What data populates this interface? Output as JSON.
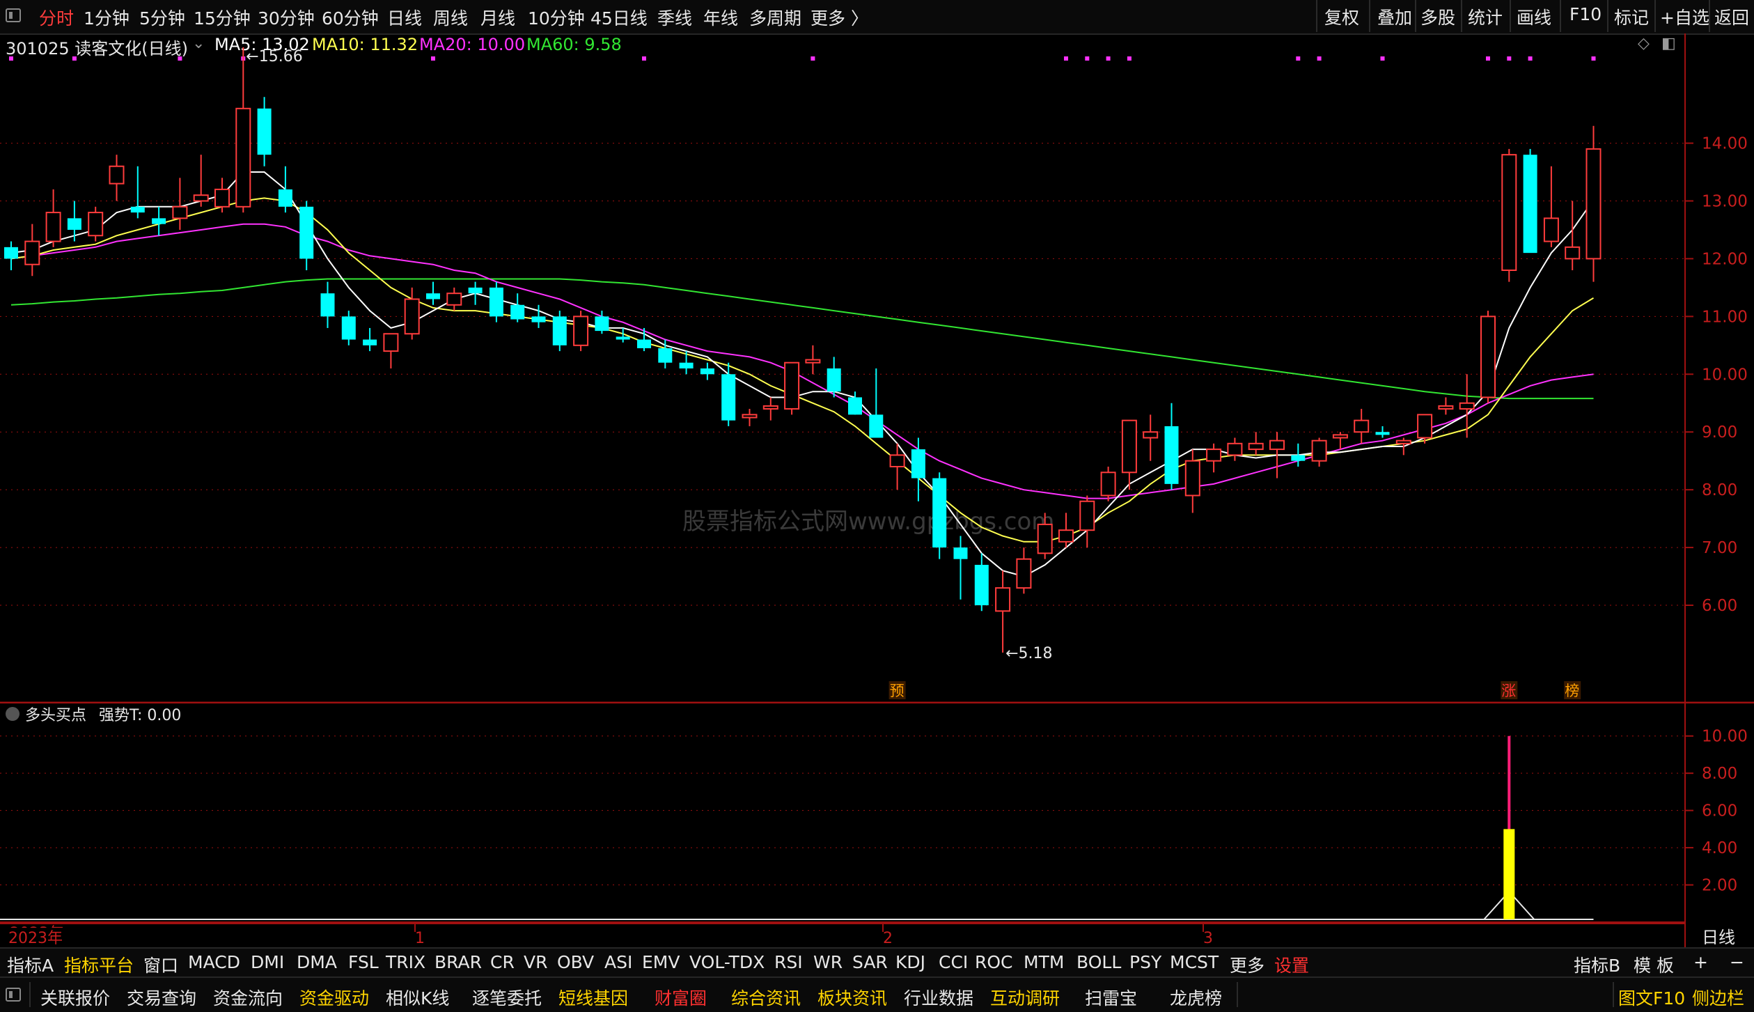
{
  "toolbar": {
    "periods": [
      "分时",
      "1分钟",
      "5分钟",
      "15分钟",
      "30分钟",
      "60分钟",
      "日线",
      "周线",
      "月线",
      "10分钟",
      "45日线",
      "季线",
      "年线",
      "多周期",
      "更多 〉"
    ],
    "active_period": "分时",
    "tools": [
      "复权",
      "叠加",
      "多股",
      "统计",
      "画线",
      "F10",
      "标记",
      "+自选",
      "返回"
    ]
  },
  "header": {
    "stock": "301025 读客文化(日线)",
    "ma5": "MA5: 13.02",
    "ma10": "MA10: 11.32",
    "ma20": "MA20: 10.00",
    "ma60": "MA60: 9.58"
  },
  "indicator_header": {
    "name": "多头买点",
    "value": "强势T: 0.00"
  },
  "watermark": "股票指标公式网www.gpzbgs.com",
  "markers": {
    "yu": "预",
    "zhang": "涨",
    "bang": "榜"
  },
  "colors": {
    "up": "#ff3c3c",
    "down": "#00ffff",
    "ma5": "#ffffff",
    "ma10": "#ffff50",
    "ma20": "#ff32ff",
    "ma60": "#32e632",
    "grid": "#a01010"
  },
  "x_labels": {
    "year": "2023年",
    "m1": "1",
    "m2": "2",
    "m3": "3",
    "corner": "日线"
  },
  "tabs": [
    "指标A",
    "指标平台",
    "窗口",
    "MACD",
    "DMI",
    "DMA",
    "FSL",
    "TRIX",
    "BRAR",
    "CR",
    "VR",
    "OBV",
    "ASI",
    "EMV",
    "VOL-TDX",
    "RSI",
    "WR",
    "SAR",
    "KDJ",
    "CCI",
    "ROC",
    "MTM",
    "BOLL",
    "PSY",
    "MCST",
    "更多",
    "设置"
  ],
  "tabs_right": [
    "指标B",
    "模 板",
    "+",
    "−"
  ],
  "bottom_tabs": [
    "关联报价",
    "交易查询",
    "资金流向",
    "资金驱动",
    "相似K线",
    "逐笔委托",
    "短线基因",
    "财富圈",
    "综合资讯",
    "板块资讯",
    "行业数据",
    "互动调研",
    "扫雷宝",
    "龙虎榜"
  ],
  "bottom_right": [
    "图文F10",
    "侧边栏"
  ],
  "chart_data": [
    {
      "type": "candlestick",
      "title": "301025 读客文化(日线)",
      "y_ticks": [
        "6.00",
        "7.00",
        "8.00",
        "9.00",
        "10.00",
        "11.00",
        "12.00",
        "13.00",
        "14.00"
      ],
      "ylim": [
        4.3,
        15.9
      ],
      "annotations": {
        "high": "15.66",
        "low": "5.18"
      },
      "ohlc": [
        [
          12.2,
          12.3,
          11.8,
          12.0
        ],
        [
          11.9,
          12.6,
          11.7,
          12.3
        ],
        [
          12.3,
          13.2,
          12.2,
          12.8
        ],
        [
          12.7,
          13.0,
          12.3,
          12.5
        ],
        [
          12.4,
          12.9,
          12.3,
          12.8
        ],
        [
          13.3,
          13.8,
          13.0,
          13.6
        ],
        [
          12.9,
          13.6,
          12.7,
          12.8
        ],
        [
          12.7,
          12.9,
          12.4,
          12.6
        ],
        [
          12.7,
          13.4,
          12.5,
          12.9
        ],
        [
          13.0,
          13.8,
          12.9,
          13.1
        ],
        [
          12.9,
          13.4,
          12.8,
          13.2
        ],
        [
          12.9,
          15.66,
          12.8,
          14.6
        ],
        [
          14.6,
          14.8,
          13.6,
          13.8
        ],
        [
          13.2,
          13.6,
          12.8,
          12.9
        ],
        [
          12.9,
          13.0,
          11.8,
          12.0
        ],
        [
          11.4,
          11.6,
          10.8,
          11.0
        ],
        [
          11.0,
          11.1,
          10.5,
          10.6
        ],
        [
          10.6,
          10.8,
          10.4,
          10.5
        ],
        [
          10.4,
          10.7,
          10.1,
          10.7
        ],
        [
          10.7,
          11.5,
          10.6,
          11.3
        ],
        [
          11.4,
          11.6,
          11.2,
          11.3
        ],
        [
          11.2,
          11.5,
          11.1,
          11.4
        ],
        [
          11.5,
          11.6,
          11.2,
          11.4
        ],
        [
          11.5,
          11.6,
          10.9,
          11.0
        ],
        [
          11.2,
          11.4,
          10.9,
          10.95
        ],
        [
          11.0,
          11.2,
          10.8,
          10.9
        ],
        [
          11.0,
          11.1,
          10.4,
          10.5
        ],
        [
          10.5,
          11.1,
          10.4,
          11.0
        ],
        [
          11.0,
          11.1,
          10.7,
          10.75
        ],
        [
          10.65,
          10.8,
          10.55,
          10.6
        ],
        [
          10.6,
          10.8,
          10.4,
          10.45
        ],
        [
          10.45,
          10.6,
          10.1,
          10.2
        ],
        [
          10.2,
          10.4,
          10.0,
          10.1
        ],
        [
          10.1,
          10.2,
          9.9,
          10.0
        ],
        [
          10.0,
          10.2,
          9.1,
          9.2
        ],
        [
          9.25,
          9.4,
          9.1,
          9.3
        ],
        [
          9.4,
          9.6,
          9.2,
          9.45
        ],
        [
          9.4,
          10.2,
          9.3,
          10.2
        ],
        [
          10.2,
          10.5,
          10.0,
          10.25
        ],
        [
          10.1,
          10.3,
          9.6,
          9.7
        ],
        [
          9.6,
          9.7,
          9.3,
          9.3
        ],
        [
          9.3,
          10.1,
          9.0,
          8.9
        ],
        [
          8.4,
          8.8,
          8.0,
          8.6
        ],
        [
          8.7,
          8.9,
          7.8,
          8.2
        ],
        [
          8.2,
          8.3,
          6.8,
          7.0
        ],
        [
          7.0,
          7.2,
          6.1,
          6.8
        ],
        [
          6.7,
          6.9,
          5.9,
          6.0
        ],
        [
          5.9,
          6.6,
          5.18,
          6.3
        ],
        [
          6.3,
          7.0,
          6.2,
          6.8
        ],
        [
          6.9,
          7.6,
          6.8,
          7.4
        ],
        [
          7.1,
          7.6,
          7.0,
          7.3
        ],
        [
          7.3,
          7.9,
          7.0,
          7.8
        ],
        [
          7.9,
          8.4,
          7.8,
          8.3
        ],
        [
          8.3,
          9.2,
          8.0,
          9.2
        ],
        [
          8.9,
          9.3,
          8.5,
          9.0
        ],
        [
          9.1,
          9.5,
          8.0,
          8.1
        ],
        [
          7.9,
          8.7,
          7.6,
          8.5
        ],
        [
          8.5,
          8.8,
          8.3,
          8.7
        ],
        [
          8.6,
          8.9,
          8.5,
          8.8
        ],
        [
          8.7,
          9.0,
          8.6,
          8.8
        ],
        [
          8.7,
          9.0,
          8.2,
          8.85
        ],
        [
          8.6,
          8.8,
          8.4,
          8.5
        ],
        [
          8.5,
          8.9,
          8.4,
          8.85
        ],
        [
          8.9,
          9.0,
          8.7,
          8.95
        ],
        [
          9.0,
          9.4,
          8.8,
          9.2
        ],
        [
          9.0,
          9.1,
          8.9,
          8.95
        ],
        [
          8.8,
          8.9,
          8.6,
          8.85
        ],
        [
          8.9,
          9.3,
          8.8,
          9.3
        ],
        [
          9.4,
          9.6,
          9.3,
          9.45
        ],
        [
          9.4,
          10.0,
          8.9,
          9.5
        ],
        [
          9.6,
          11.1,
          9.5,
          11.0
        ],
        [
          11.8,
          13.9,
          11.6,
          13.8
        ],
        [
          13.8,
          13.9,
          12.2,
          12.1
        ],
        [
          12.3,
          13.6,
          12.2,
          12.7
        ],
        [
          12.0,
          13.0,
          11.8,
          12.2
        ],
        [
          12.0,
          14.3,
          11.6,
          13.9
        ]
      ],
      "ma5": [
        12.1,
        12.15,
        12.3,
        12.4,
        12.5,
        12.8,
        12.9,
        12.9,
        12.9,
        13.0,
        13.1,
        13.5,
        13.5,
        13.2,
        12.6,
        12.0,
        11.5,
        11.1,
        10.8,
        10.9,
        11.1,
        11.3,
        11.4,
        11.3,
        11.2,
        11.1,
        10.95,
        10.9,
        10.8,
        10.8,
        10.7,
        10.5,
        10.4,
        10.3,
        10.0,
        9.8,
        9.6,
        9.6,
        9.7,
        9.7,
        9.6,
        9.2,
        8.8,
        8.3,
        7.9,
        7.4,
        6.9,
        6.6,
        6.5,
        6.7,
        7.0,
        7.3,
        7.7,
        8.1,
        8.3,
        8.5,
        8.7,
        8.7,
        8.6,
        8.55,
        8.6,
        8.6,
        8.65,
        8.65,
        8.7,
        8.75,
        8.75,
        8.9,
        9.1,
        9.3,
        9.7,
        10.8,
        11.5,
        12.1,
        12.5,
        13.02
      ],
      "ma10": [
        12.0,
        12.05,
        12.15,
        12.2,
        12.25,
        12.4,
        12.5,
        12.6,
        12.7,
        12.8,
        12.9,
        13.0,
        13.05,
        13.0,
        12.8,
        12.5,
        12.1,
        11.8,
        11.5,
        11.3,
        11.15,
        11.1,
        11.1,
        11.05,
        11.0,
        10.95,
        10.9,
        10.85,
        10.8,
        10.7,
        10.55,
        10.45,
        10.35,
        10.25,
        10.15,
        10.0,
        9.8,
        9.65,
        9.5,
        9.35,
        9.1,
        8.8,
        8.5,
        8.2,
        7.9,
        7.6,
        7.35,
        7.2,
        7.1,
        7.1,
        7.2,
        7.35,
        7.6,
        7.8,
        8.1,
        8.35,
        8.5,
        8.55,
        8.6,
        8.6,
        8.6,
        8.6,
        8.6,
        8.65,
        8.7,
        8.75,
        8.8,
        8.85,
        8.95,
        9.05,
        9.3,
        9.8,
        10.3,
        10.7,
        11.1,
        11.32
      ],
      "ma20": [
        12.0,
        12.05,
        12.1,
        12.15,
        12.2,
        12.3,
        12.35,
        12.4,
        12.45,
        12.5,
        12.55,
        12.6,
        12.6,
        12.55,
        12.4,
        12.3,
        12.15,
        12.05,
        12.0,
        11.95,
        11.9,
        11.8,
        11.75,
        11.6,
        11.5,
        11.4,
        11.3,
        11.15,
        11.0,
        10.9,
        10.75,
        10.6,
        10.5,
        10.4,
        10.35,
        10.3,
        10.2,
        10.05,
        9.85,
        9.65,
        9.45,
        9.2,
        8.95,
        8.7,
        8.5,
        8.35,
        8.2,
        8.1,
        8.0,
        7.95,
        7.9,
        7.85,
        7.85,
        7.9,
        7.95,
        8.0,
        8.05,
        8.1,
        8.2,
        8.3,
        8.4,
        8.5,
        8.6,
        8.7,
        8.8,
        8.85,
        8.95,
        9.05,
        9.15,
        9.3,
        9.5,
        9.65,
        9.8,
        9.9,
        9.95,
        10.0
      ],
      "ma60": [
        11.2,
        11.22,
        11.25,
        11.27,
        11.3,
        11.32,
        11.35,
        11.38,
        11.4,
        11.43,
        11.45,
        11.5,
        11.55,
        11.6,
        11.63,
        11.65,
        11.65,
        11.65,
        11.65,
        11.65,
        11.65,
        11.65,
        11.65,
        11.65,
        11.65,
        11.65,
        11.65,
        11.63,
        11.6,
        11.58,
        11.55,
        11.5,
        11.45,
        11.4,
        11.35,
        11.3,
        11.25,
        11.2,
        11.15,
        11.1,
        11.05,
        11.0,
        10.95,
        10.9,
        10.85,
        10.8,
        10.75,
        10.7,
        10.65,
        10.6,
        10.55,
        10.5,
        10.45,
        10.4,
        10.35,
        10.3,
        10.25,
        10.2,
        10.15,
        10.1,
        10.05,
        10.0,
        9.95,
        9.9,
        9.85,
        9.8,
        9.75,
        9.7,
        9.66,
        9.62,
        9.6,
        9.58,
        9.58,
        9.58,
        9.58,
        9.58
      ]
    },
    {
      "type": "bar",
      "title": "多头买点",
      "y_ticks": [
        "2.00",
        "4.00",
        "6.00",
        "8.00",
        "10.00"
      ],
      "ylim": [
        0,
        11
      ],
      "series": [
        {
          "name": "强势T",
          "values": [
            0,
            0,
            0,
            0,
            0,
            0,
            0,
            0,
            0,
            0,
            0,
            0,
            0,
            0,
            0,
            0,
            0,
            0,
            0,
            0,
            0,
            0,
            0,
            0,
            0,
            0,
            0,
            0,
            0,
            0,
            0,
            0,
            0,
            0,
            0,
            0,
            0,
            0,
            0,
            0,
            0,
            0,
            0,
            0,
            0,
            0,
            0,
            0,
            0,
            0,
            0,
            0,
            0,
            0,
            0,
            0,
            0,
            0,
            0,
            0,
            0,
            0,
            0,
            0,
            0,
            0,
            0,
            0,
            0,
            0,
            0,
            10,
            0,
            0,
            0,
            0
          ]
        },
        {
          "name": "多头买点",
          "values": [
            0,
            0,
            0,
            0,
            0,
            0,
            0,
            0,
            0,
            0,
            0,
            0,
            0,
            0,
            0,
            0,
            0,
            0,
            0,
            0,
            0,
            0,
            0,
            0,
            0,
            0,
            0,
            0,
            0,
            0,
            0,
            0,
            0,
            0,
            0,
            0,
            0,
            0,
            0,
            0,
            0,
            0,
            0,
            0,
            0,
            0,
            0,
            0,
            0,
            0,
            0,
            0,
            0,
            0,
            0,
            0,
            0,
            0,
            0,
            0,
            0,
            0,
            0,
            0,
            0,
            0,
            0,
            0,
            0,
            0,
            0,
            5,
            0,
            0,
            0,
            0
          ]
        }
      ]
    }
  ]
}
